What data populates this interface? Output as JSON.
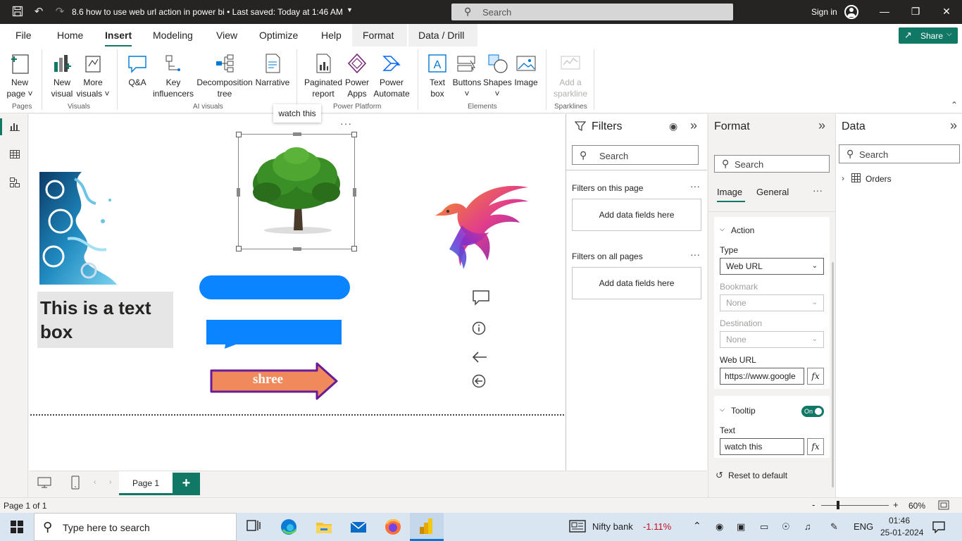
{
  "titlebar": {
    "doc_title": "8.6 how to use web url action in power bi • Last saved: Today at 1:46 AM",
    "search_placeholder": "Search",
    "signin": "Sign in"
  },
  "menu": {
    "tabs": [
      "File",
      "Home",
      "Insert",
      "Modeling",
      "View",
      "Optimize",
      "Help",
      "Format",
      "Data / Drill"
    ],
    "active_tab": "Insert",
    "share_label": "Share"
  },
  "ribbon": {
    "groups": {
      "pages": "Pages",
      "visuals": "Visuals",
      "ai": "AI visuals",
      "platform": "Power Platform",
      "elements": "Elements",
      "sparklines": "Sparklines"
    },
    "buttons": {
      "new_page": [
        "New",
        "page"
      ],
      "new_visual": [
        "New",
        "visual"
      ],
      "more_visuals": [
        "More",
        "visuals"
      ],
      "qa": [
        "Q&A"
      ],
      "key_influencers": [
        "Key",
        "influencers"
      ],
      "decomposition_tree": [
        "Decomposition",
        "tree"
      ],
      "narrative": [
        "Narrative"
      ],
      "paginated_report": [
        "Paginated",
        "report"
      ],
      "power_apps": [
        "Power",
        "Apps"
      ],
      "power_automate": [
        "Power",
        "Automate"
      ],
      "text_box": [
        "Text",
        "box"
      ],
      "buttons": [
        "Buttons"
      ],
      "shapes": [
        "Shapes"
      ],
      "image": [
        "Image"
      ],
      "add_sparkline": [
        "Add a",
        "sparkline"
      ]
    }
  },
  "canvas": {
    "tooltip": "watch this",
    "textbox_text": "This is a text box",
    "arrow_label": "shree"
  },
  "filters_pane": {
    "title": "Filters",
    "search_placeholder": "Search",
    "on_this_page": "Filters on this page",
    "on_all_pages": "Filters on all pages",
    "add_fields": "Add data fields here"
  },
  "format_pane": {
    "title": "Format",
    "search_placeholder": "Search",
    "tabs": [
      "Image",
      "General"
    ],
    "action": {
      "header": "Action",
      "type_label": "Type",
      "type_value": "Web URL",
      "bookmark_label": "Bookmark",
      "bookmark_value": "None",
      "destination_label": "Destination",
      "destination_value": "None",
      "weburl_label": "Web URL",
      "weburl_value": "https://www.google"
    },
    "tooltip": {
      "header": "Tooltip",
      "toggle": "On",
      "text_label": "Text",
      "text_value": "watch this"
    },
    "reset": "Reset to default",
    "fx": "fx"
  },
  "data_pane": {
    "title": "Data",
    "search_placeholder": "Search",
    "tables": [
      "Orders"
    ]
  },
  "page_tabs": {
    "pages": [
      "Page 1"
    ],
    "add": "+"
  },
  "status": {
    "page_indicator": "Page 1 of 1",
    "zoom_minus": "-",
    "zoom_plus": "+",
    "zoom_value": "60%"
  },
  "taskbar": {
    "search_placeholder": "Type here to search",
    "stock_name": "Nifty bank",
    "stock_change": "-1.11%",
    "language": "ENG",
    "time": "01:46",
    "date": "25-01-2024"
  },
  "colors": {
    "accent": "#117865",
    "button_blue": "#0a84ff",
    "arrow_fill": "#f08a5d",
    "arrow_border": "#6a1b9a",
    "stock_negative": "#c50f1f"
  }
}
